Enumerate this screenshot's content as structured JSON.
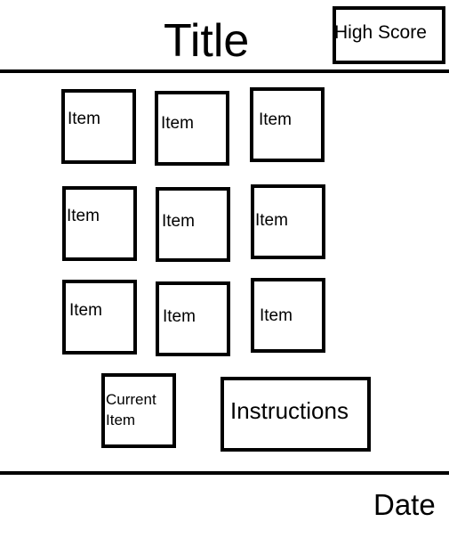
{
  "header": {
    "title": "Title",
    "high_score_label": "High Score"
  },
  "grid": {
    "items": [
      "Item",
      "Item",
      "Item",
      "Item",
      "Item",
      "Item",
      "Item",
      "Item",
      "Item"
    ]
  },
  "controls": {
    "current_item_label": "Current Item",
    "instructions_label": "Instructions"
  },
  "footer": {
    "date_label": "Date"
  }
}
